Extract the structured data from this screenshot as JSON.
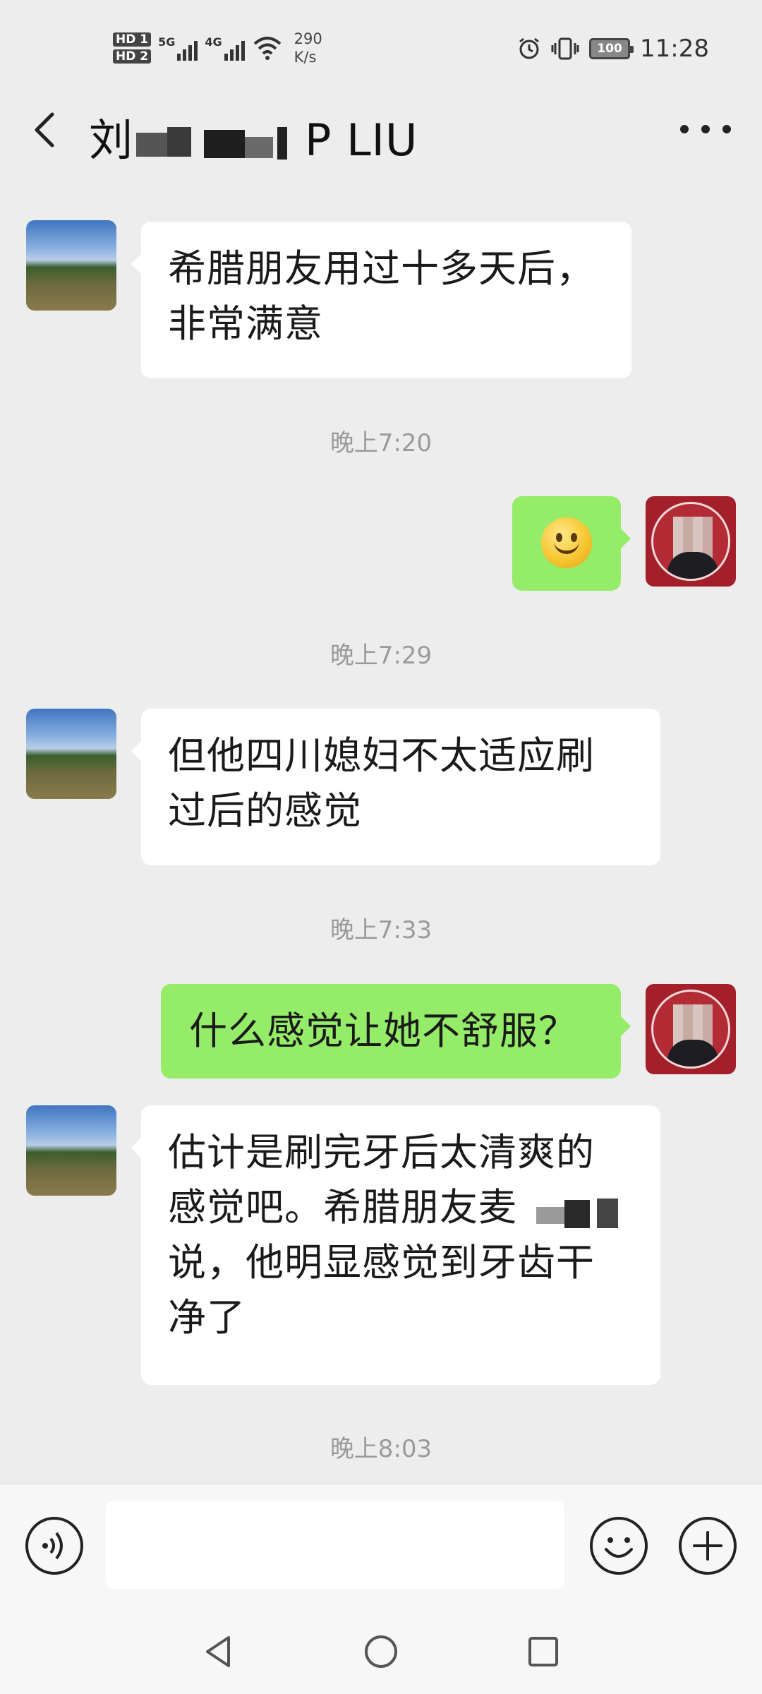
{
  "status_bar": {
    "hd1": "HD 1",
    "hd2": "HD 2",
    "net1": "5G",
    "net2": "4G",
    "speed_value": "290",
    "speed_unit": "K/s",
    "battery": "100",
    "time": "11:28"
  },
  "header": {
    "title_prefix": "刘",
    "title_suffix": "P LIU",
    "back_icon": "chevron-left-icon",
    "more_icon": "more-dots-icon"
  },
  "messages": [
    {
      "side": "incoming",
      "text": "希腊朋友用过十多天后，\n非常满意"
    },
    {
      "side": "timestamp",
      "text": "晚上7:20"
    },
    {
      "side": "outgoing",
      "emoji": "smiley-emoji"
    },
    {
      "side": "timestamp",
      "text": "晚上7:29"
    },
    {
      "side": "incoming",
      "text": "但他四川媳妇不太适应刷\n过后的感觉"
    },
    {
      "side": "timestamp",
      "text": "晚上7:33"
    },
    {
      "side": "outgoing",
      "text": "什么感觉让她不舒服？"
    },
    {
      "side": "incoming",
      "text": "估计是刷完牙后太清爽的\n感觉吧。希腊朋友麦"
    },
    {
      "side": "incoming_cont",
      "text": "说，他明显感觉到牙齿干\n净了"
    },
    {
      "side": "timestamp",
      "text": "晚上8:03"
    }
  ],
  "input_bar": {
    "voice_icon": "voice-icon",
    "emoji_icon": "emoji-icon",
    "plus_icon": "plus-icon",
    "placeholder": ""
  },
  "nav_bar": {
    "back": "nav-back-icon",
    "home": "nav-home-icon",
    "recents": "nav-recents-icon"
  },
  "colors": {
    "background": "#ededed",
    "incoming_bubble": "#ffffff",
    "outgoing_bubble": "#95ec69",
    "timestamp": "#9a9a9a",
    "seal_red": "#a3202b"
  }
}
